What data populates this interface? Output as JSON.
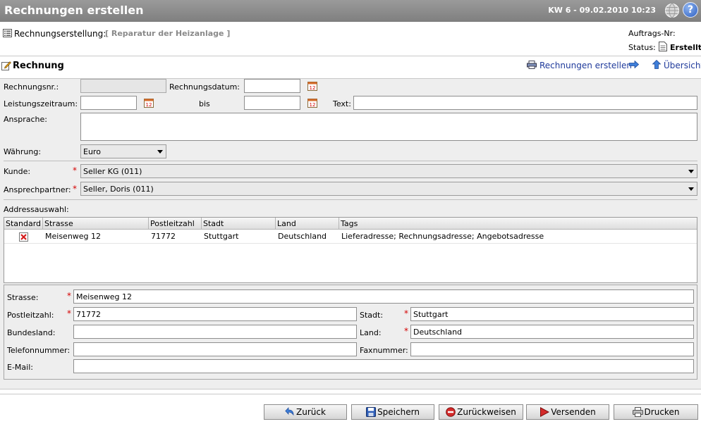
{
  "header": {
    "title": "Rechnungen erstellen",
    "week_date": "KW 6 - 09.02.2010 10:23",
    "help_glyph": "?"
  },
  "info": {
    "label": "Rechnungserstellung:",
    "subject": "[ Reparatur der Heizanlage ]",
    "order_label": "Auftrags-Nr:",
    "status_label": "Status:",
    "status_value": "Erstellt"
  },
  "section": {
    "title": "Rechnung",
    "link_create": "Rechnungen erstellen",
    "link_overview": "Übersicht"
  },
  "form": {
    "invoice_no_label": "Rechnungsnr.:",
    "invoice_no_value": "",
    "invoice_date_label": "Rechnungsdatum:",
    "invoice_date_value": "",
    "period_label": "Leistungszeitraum:",
    "period_from_value": "",
    "to_label": "bis",
    "period_to_value": "",
    "text_label": "Text:",
    "text_value": "",
    "salutation_label": "Ansprache:",
    "salutation_value": "",
    "currency_label": "Währung:",
    "currency_value": "Euro",
    "customer_label": "Kunde:",
    "customer_value": "Seller KG (011)",
    "contact_label": "Ansprechpartner:",
    "contact_value": "Seller, Doris (011)",
    "address_selection_label": "Addressauswahl:"
  },
  "address_table": {
    "columns": [
      "Standard",
      "Strasse",
      "Postleitzahl",
      "Stadt",
      "Land",
      "Tags"
    ],
    "rows": [
      {
        "street": "Meisenweg 12",
        "zip": "71772",
        "city": "Stuttgart",
        "country": "Deutschland",
        "tags": "Lieferadresse; Rechnungsadresse; Angebotsadresse"
      }
    ]
  },
  "address": {
    "street_label": "Strasse:",
    "street_value": "Meisenweg 12",
    "zip_label": "Postleitzahl:",
    "zip_value": "71772",
    "city_label": "Stadt:",
    "city_value": "Stuttgart",
    "state_label": "Bundesland:",
    "state_value": "",
    "country_label": "Land:",
    "country_value": "Deutschland",
    "phone_label": "Telefonnummer:",
    "phone_value": "",
    "fax_label": "Faxnummer:",
    "fax_value": "",
    "email_label": "E-Mail:",
    "email_value": ""
  },
  "required_marker": "*",
  "buttons": {
    "back": "Zurück",
    "save": "Speichern",
    "reject": "Zurückweisen",
    "send": "Versenden",
    "print": "Drucken"
  },
  "colors": {
    "header_bg": "#8c8c8c",
    "panel_bg": "#eeeeee",
    "link": "#1f3a9b",
    "required": "#d40000"
  }
}
